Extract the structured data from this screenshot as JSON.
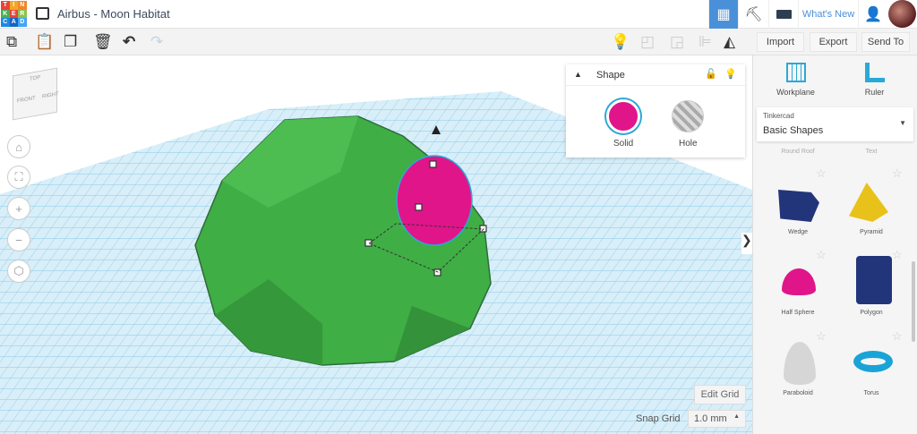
{
  "app": {
    "logo": [
      "T",
      "I",
      "N",
      "K",
      "E",
      "R",
      "C",
      "A",
      "D"
    ],
    "title": "Airbus - Moon Habitat"
  },
  "header": {
    "whats_new": "What's New"
  },
  "toolbar": {
    "import": "Import",
    "export": "Export",
    "send_to": "Send To"
  },
  "shape_panel": {
    "title": "Shape",
    "solid": "Solid",
    "hole": "Hole",
    "solid_color": "#e0158a"
  },
  "viewcube": {
    "top": "TOP",
    "front": "FRONT",
    "right": "RIGHT"
  },
  "sidebar": {
    "workplane": "Workplane",
    "ruler": "Ruler",
    "library_group": "Tinkercad",
    "library": "Basic Shapes",
    "cut_labels": [
      "Round Roof",
      "Text"
    ],
    "shapes": [
      {
        "label": "Wedge"
      },
      {
        "label": "Pyramid"
      },
      {
        "label": "Half Sphere"
      },
      {
        "label": "Polygon"
      },
      {
        "label": "Paraboloid"
      },
      {
        "label": "Torus"
      }
    ]
  },
  "grid": {
    "edit_grid": "Edit Grid",
    "snap_label": "Snap Grid",
    "snap_value": "1.0 mm"
  }
}
